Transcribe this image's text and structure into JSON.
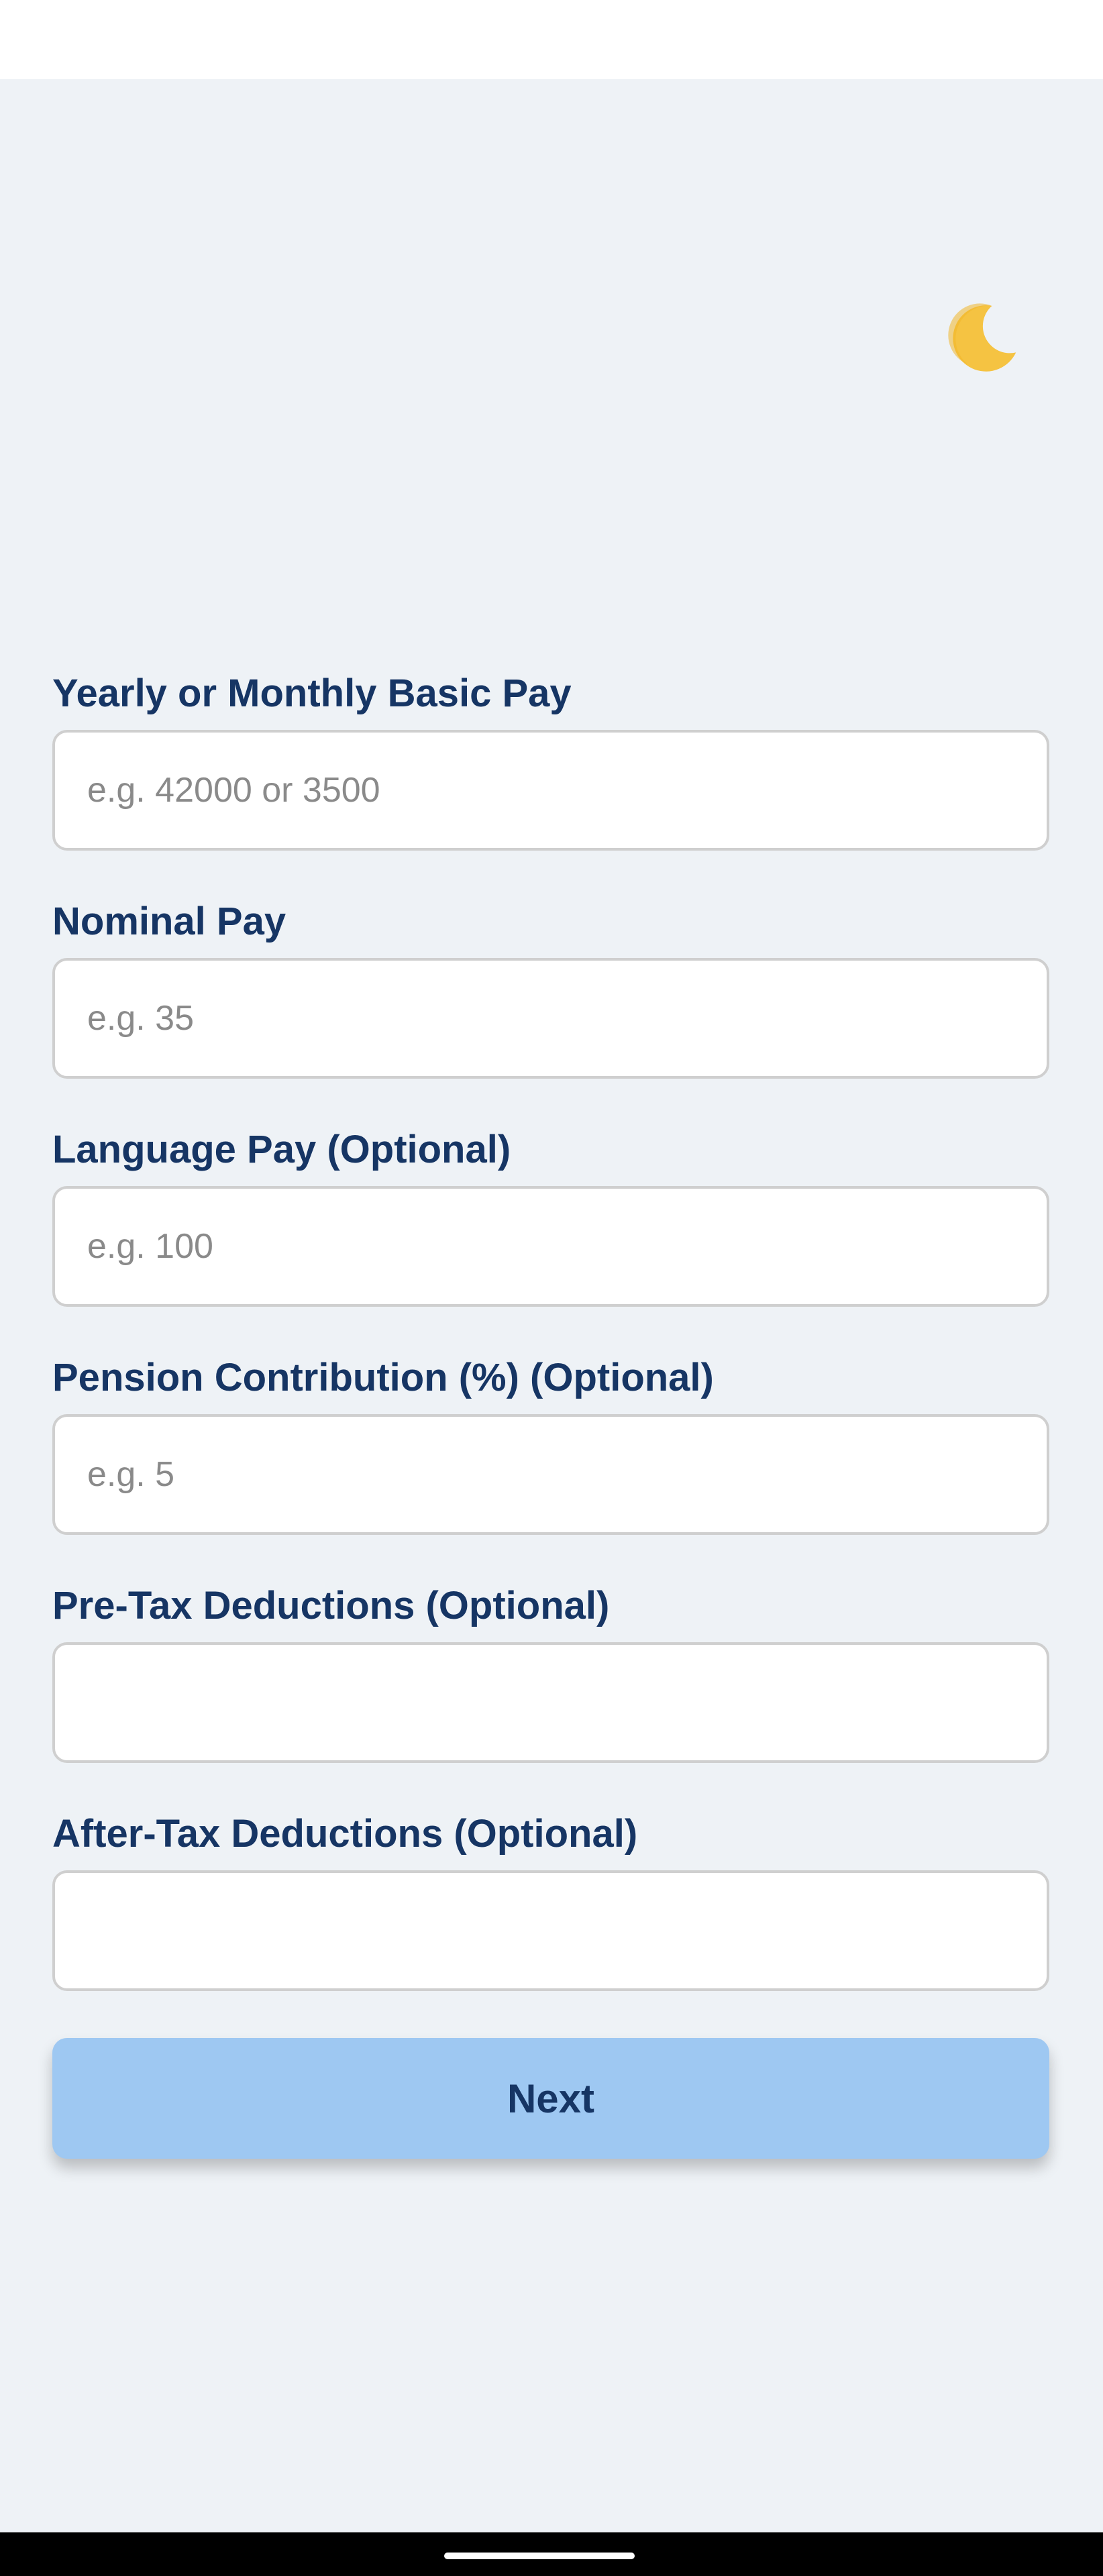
{
  "header": {
    "theme_toggle_icon": "crescent-moon-icon",
    "moon_color": "#f5c342"
  },
  "form": {
    "fields": [
      {
        "label": "Yearly or Monthly Basic Pay",
        "placeholder": "e.g. 42000 or 3500",
        "value": ""
      },
      {
        "label": "Nominal Pay",
        "placeholder": "e.g. 35",
        "value": ""
      },
      {
        "label": "Language Pay (Optional)",
        "placeholder": "e.g. 100",
        "value": ""
      },
      {
        "label": "Pension Contribution (%) (Optional)",
        "placeholder": "e.g. 5",
        "value": ""
      },
      {
        "label": "Pre-Tax Deductions (Optional)",
        "placeholder": "",
        "value": ""
      },
      {
        "label": "After-Tax Deductions (Optional)",
        "placeholder": "",
        "value": ""
      }
    ],
    "next_label": "Next"
  },
  "colors": {
    "background": "#eef2f6",
    "label": "#163564",
    "button": "#9ec8f2"
  }
}
